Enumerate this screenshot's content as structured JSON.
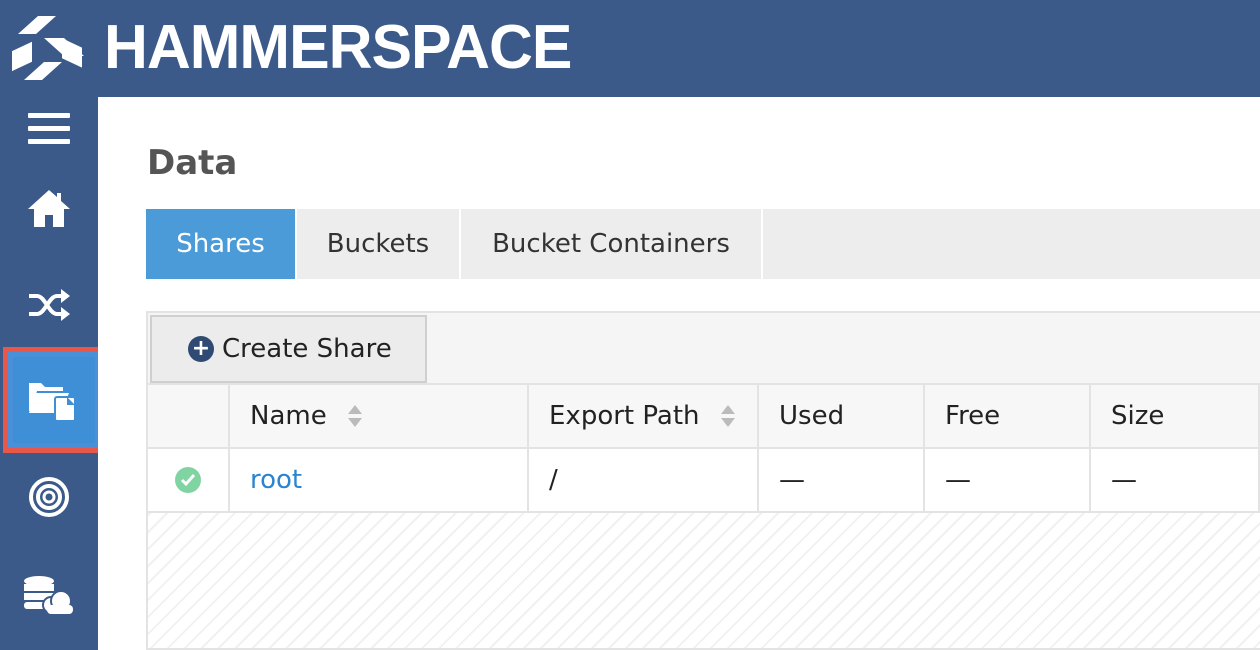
{
  "app": {
    "brand": "HAMMERSPACE"
  },
  "sidebar": {
    "items": [
      {
        "name": "menu",
        "icon": "hamburger-icon"
      },
      {
        "name": "home",
        "icon": "home-icon"
      },
      {
        "name": "shuffle",
        "icon": "shuffle-icon"
      },
      {
        "name": "data",
        "icon": "folders-icon",
        "active": true
      },
      {
        "name": "objectives",
        "icon": "target-icon"
      },
      {
        "name": "storage",
        "icon": "database-cloud-icon"
      }
    ]
  },
  "page": {
    "title": "Data"
  },
  "tabs": [
    {
      "label": "Shares",
      "active": true
    },
    {
      "label": "Buckets",
      "active": false
    },
    {
      "label": "Bucket Containers",
      "active": false
    }
  ],
  "toolbar": {
    "create_label": "Create Share"
  },
  "table": {
    "columns": [
      "",
      "Name",
      "Export Path",
      "Used",
      "Free",
      "Size"
    ],
    "rows": [
      {
        "status": "ok",
        "name": "root",
        "export_path": "/",
        "used": "—",
        "free": "—",
        "size": "—"
      }
    ]
  },
  "colors": {
    "brand": "#3b5a89",
    "accent": "#4a9bd8",
    "highlight": "#e8574a",
    "link": "#2a84d2",
    "ok": "#7fd4a2"
  }
}
